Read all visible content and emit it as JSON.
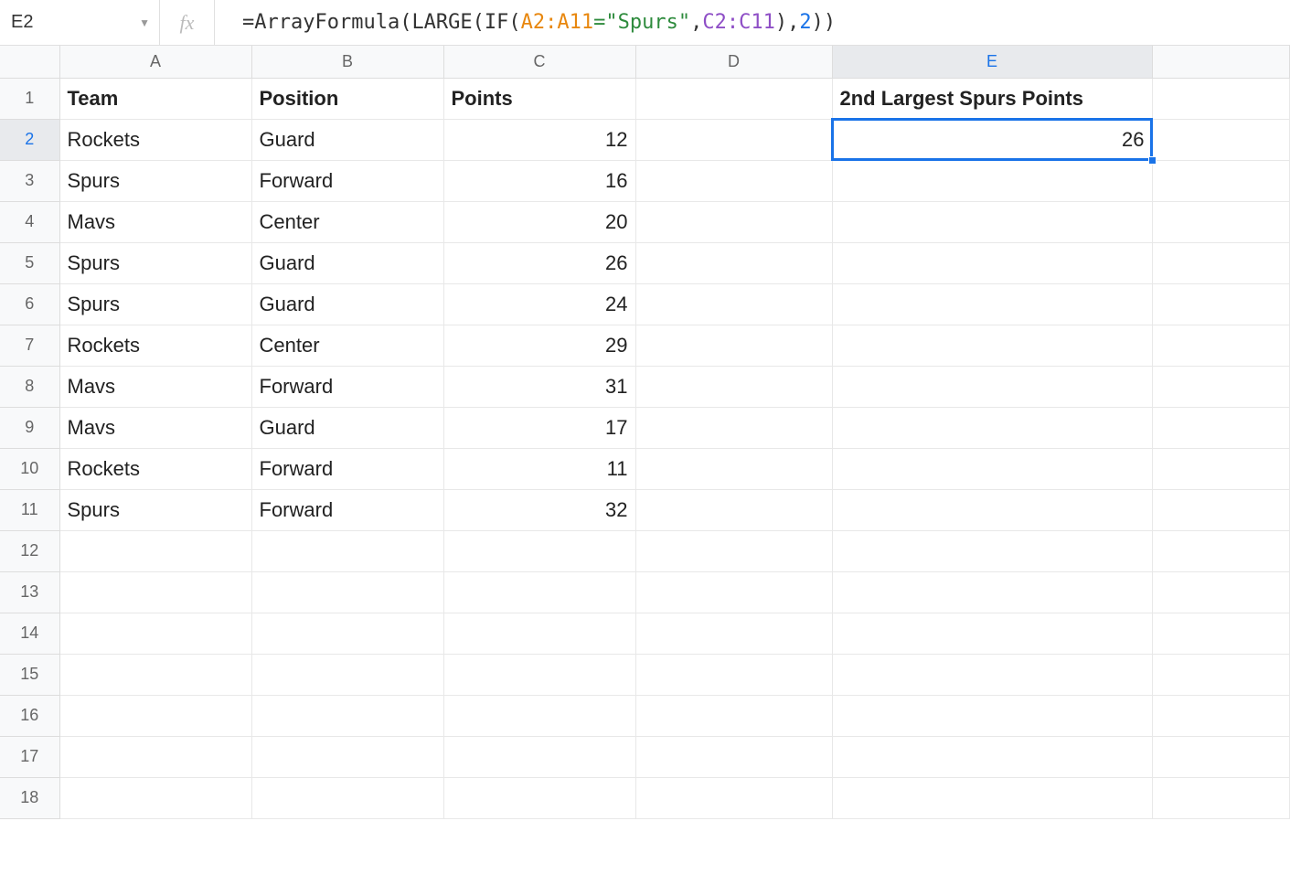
{
  "nameBox": "E2",
  "formula": {
    "prefix": "=ArrayFormula",
    "large": "LARGE",
    "if": "IF",
    "refA": "A2:A11",
    "eqStr": "=\"Spurs\"",
    "refC": "C2:C11",
    "num": "2"
  },
  "columns": [
    "A",
    "B",
    "C",
    "D",
    "E"
  ],
  "rowCount": 18,
  "selectedCell": {
    "row": 2,
    "col": "E"
  },
  "headers": {
    "A": "Team",
    "B": "Position",
    "C": "Points",
    "E": "2nd Largest Spurs Points"
  },
  "data": [
    {
      "team": "Rockets",
      "position": "Guard",
      "points": "12"
    },
    {
      "team": "Spurs",
      "position": "Forward",
      "points": "16"
    },
    {
      "team": "Mavs",
      "position": "Center",
      "points": "20"
    },
    {
      "team": "Spurs",
      "position": "Guard",
      "points": "26"
    },
    {
      "team": "Spurs",
      "position": "Guard",
      "points": "24"
    },
    {
      "team": "Rockets",
      "position": "Center",
      "points": "29"
    },
    {
      "team": "Mavs",
      "position": "Forward",
      "points": "31"
    },
    {
      "team": "Mavs",
      "position": "Guard",
      "points": "17"
    },
    {
      "team": "Rockets",
      "position": "Forward",
      "points": "11"
    },
    {
      "team": "Spurs",
      "position": "Forward",
      "points": "32"
    }
  ],
  "resultE2": "26"
}
